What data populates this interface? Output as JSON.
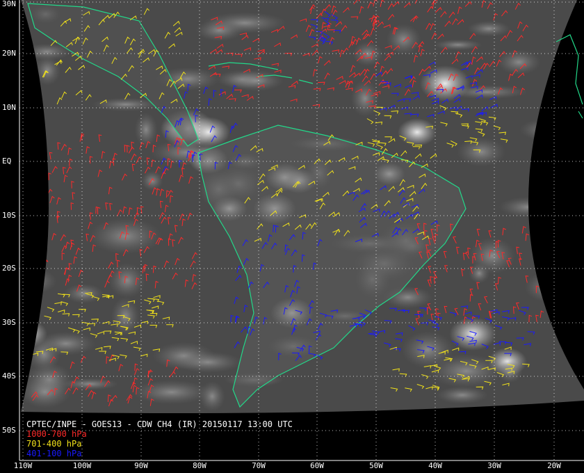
{
  "title": "CPTEC/INPE - GOES13 - CDW CH4 (IR) 20150117 13:00 UTC",
  "legend": [
    {
      "label": "1000-700 hPa",
      "color": "#ff2a2a"
    },
    {
      "label": "701-400 hPa",
      "color": "#f2e21a"
    },
    {
      "label": "401-100 hPa",
      "color": "#1a1aff"
    }
  ],
  "lat_labels": [
    "30N",
    "20N",
    "10N",
    "EQ",
    "10S",
    "20S",
    "30S",
    "40S",
    "50S"
  ],
  "lon_labels": [
    "110W",
    "100W",
    "90W",
    "80W",
    "70W",
    "60W",
    "50W",
    "40W",
    "30W",
    "20W"
  ],
  "colors": {
    "coastline": "#22d98a",
    "grid": "#ffffff",
    "space": "#000000",
    "text": "#ffffff"
  }
}
